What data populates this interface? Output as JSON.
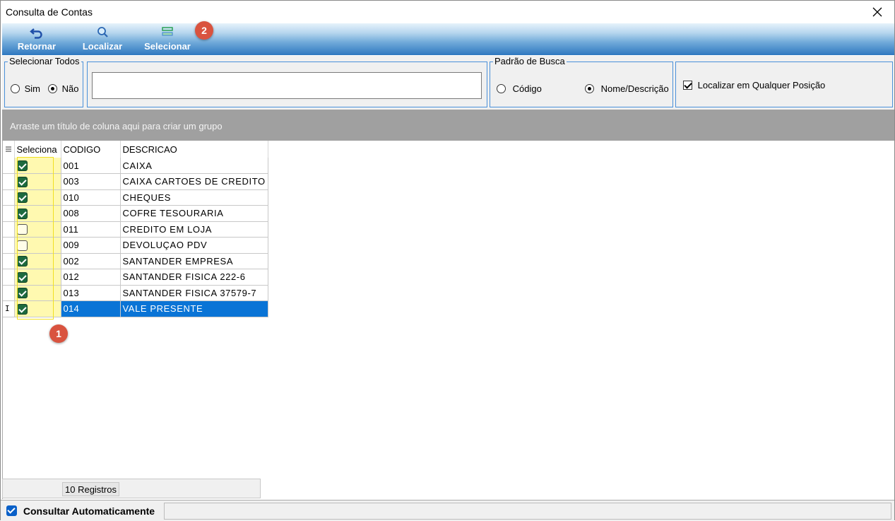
{
  "window": {
    "title": "Consulta de Contas"
  },
  "toolbar": {
    "retornar": "Retornar",
    "localizar": "Localizar",
    "selecionar": "Selecionar"
  },
  "badges": {
    "one": "1",
    "two": "2"
  },
  "selecionar_todos": {
    "legend": "Selecionar Todos",
    "sim": "Sim",
    "nao": "Não",
    "selected": "Não"
  },
  "search": {
    "value": "",
    "placeholder": ""
  },
  "padrao_busca": {
    "legend": "Padrão de Busca",
    "codigo": "Código",
    "nome": "Nome/Descrição",
    "selected": "Nome/Descrição"
  },
  "localizar_qualquer": {
    "label": "Localizar em Qualquer Posição",
    "checked": true
  },
  "groupbar": {
    "hint": "Arraste um título de coluna aqui para criar um grupo"
  },
  "grid": {
    "columns": [
      "Seleciona",
      "CODIGO",
      "DESCRICAO"
    ],
    "rows": [
      {
        "checked": true,
        "codigo": "001",
        "descricao": "CAIXA"
      },
      {
        "checked": true,
        "codigo": "003",
        "descricao": "CAIXA CARTOES DE CREDITO"
      },
      {
        "checked": true,
        "codigo": "010",
        "descricao": "CHEQUES"
      },
      {
        "checked": true,
        "codigo": "008",
        "descricao": "COFRE TESOURARIA"
      },
      {
        "checked": false,
        "codigo": "011",
        "descricao": "CREDITO EM LOJA"
      },
      {
        "checked": false,
        "codigo": "009",
        "descricao": "DEVOLUÇAO PDV"
      },
      {
        "checked": true,
        "codigo": "002",
        "descricao": "SANTANDER EMPRESA"
      },
      {
        "checked": true,
        "codigo": "012",
        "descricao": "SANTANDER FISICA 222-6"
      },
      {
        "checked": true,
        "codigo": "013",
        "descricao": "SANTANDER FISICA 37579-7"
      },
      {
        "checked": true,
        "codigo": "014",
        "descricao": "VALE PRESENTE"
      }
    ],
    "selected_row": 9,
    "footer_count": "10 Registros"
  },
  "status": {
    "consultar_auto": "Consultar Automaticamente",
    "checked": true
  },
  "colors": {
    "accent": "#0a74d6",
    "checked_box": "#1e6a3e",
    "badge": "#d9533f",
    "highlight": "#fff9b0"
  }
}
